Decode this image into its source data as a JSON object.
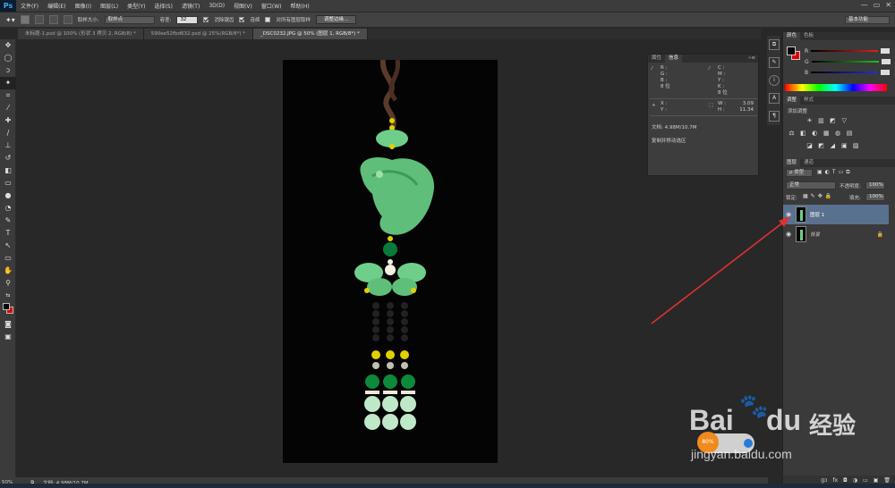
{
  "app": {
    "logo": "Ps"
  },
  "menu": [
    "文件(F)",
    "编辑(E)",
    "图像(I)",
    "图层(L)",
    "类型(Y)",
    "选择(S)",
    "滤镜(T)",
    "3D(D)",
    "视图(V)",
    "窗口(W)",
    "帮助(H)"
  ],
  "window_controls": [
    "—",
    "▭",
    "✕"
  ],
  "options_bar": {
    "sample_size_label": "取样大小:",
    "sample_size_value": "取样点",
    "tolerance_label": "容差:",
    "tolerance_value": "32",
    "anti_alias_label": "消除锯齿",
    "contiguous_label": "连续",
    "sample_all_label": "对所有图层取样",
    "refine_edge_button": "调整边缘...",
    "workspace": "基本功能"
  },
  "tabs": [
    {
      "label": "未标题-1.psd @ 100% (形状 3 拷贝 2, RGB/8) *",
      "active": false
    },
    {
      "label": "590ee52fbd632.psd @ 25%(RGB/8*) *",
      "active": false
    },
    {
      "label": "_DSC0232.JPG @ 50% (图层 1, RGB/8*) *",
      "active": true
    }
  ],
  "info_panel": {
    "tabs": [
      "属性",
      "信息"
    ],
    "left_block": [
      "R :",
      "G :",
      "B :",
      "8 位"
    ],
    "right_block": [
      "C :",
      "M :",
      "Y :",
      "K :",
      "8 位"
    ],
    "xy": [
      "X :",
      "Y :"
    ],
    "wh": [
      "W :",
      "H :"
    ],
    "w_value": "3.09",
    "h_value": "11.34",
    "doc_size": "文档: 4.98M/10.7M",
    "hint": "复制并移动选区"
  },
  "dock_icons": [
    "history-icon",
    "brush-preset-icon",
    "info-icon",
    "character-icon",
    "paragraph-icon"
  ],
  "color_panel": {
    "tabs": [
      "颜色",
      "色板"
    ],
    "channels": [
      "R",
      "G",
      "B"
    ],
    "colors": {
      "r_track": "#e02020",
      "g_track": "#20c020",
      "b_track": "#2030e0",
      "fg": "#000000",
      "bg": "#e00000"
    }
  },
  "adjust_panel": {
    "tabs": [
      "调整",
      "样式"
    ],
    "title": "添加调整",
    "row1": [
      "☀",
      "▥",
      "◩",
      "▽"
    ],
    "row2": [
      "⚖",
      "◧",
      "◐",
      "▦",
      "◍",
      "▤"
    ],
    "row3": [
      "◪",
      "◩",
      "◢",
      "▣",
      "▨"
    ]
  },
  "layers_panel": {
    "tabs": [
      "图层",
      "通道"
    ],
    "filter": "ρ 类型",
    "blend_mode": "正常",
    "opacity_label": "不透明度:",
    "opacity_value": "100%",
    "lock_label": "锁定:",
    "fill_label": "填充:",
    "fill_value": "100%",
    "layers": [
      {
        "name": "图层 1",
        "selected": true
      },
      {
        "name": "背景",
        "selected": false,
        "locked": true
      }
    ],
    "footer": [
      "ɡɔ",
      "fx",
      "◘",
      "◑",
      "▭",
      "▣",
      "🗑"
    ]
  },
  "status_bar": {
    "zoom": "50%",
    "doc": "文档: 4.98M/10.7M"
  },
  "widget": {
    "percent": "80%"
  },
  "watermark": {
    "brand": "Bai",
    "brand2": "du",
    "product": "经验",
    "url": "jingyan.baidu.com"
  }
}
